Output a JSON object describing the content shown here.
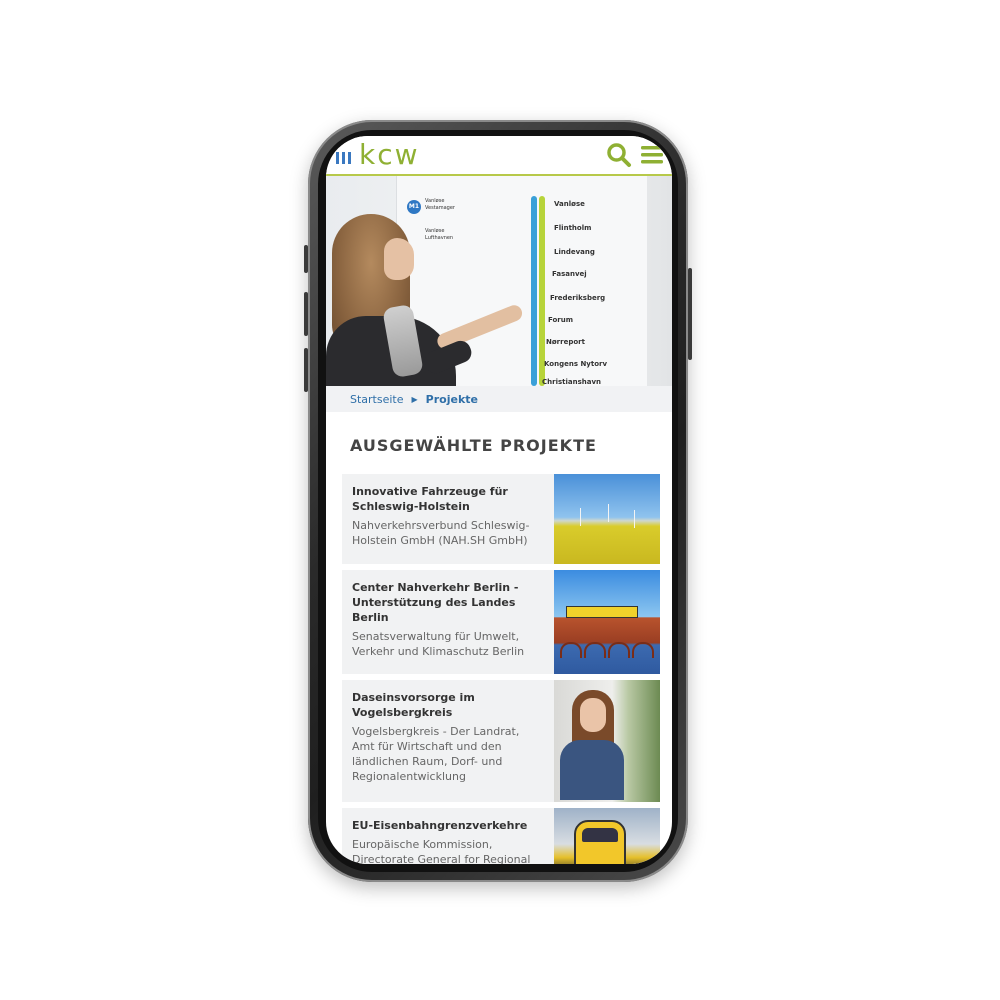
{
  "header": {
    "logo_text": "kcw",
    "search_icon": "search-icon",
    "menu_icon": "hamburger-menu-icon"
  },
  "hero": {
    "stations": [
      "Vanløse",
      "Flintholm",
      "Lindevang",
      "Fasanvej",
      "Frederiksberg",
      "Forum",
      "Nørreport",
      "Kongens Nytorv",
      "Christianshavn"
    ],
    "left_sign": {
      "badge": "M1",
      "line1": "Vanløse",
      "line2": "Vestamager",
      "line3": "Vanløse",
      "line4": "Lufthavnen"
    }
  },
  "breadcrumb": {
    "home": "Startseite",
    "separator_icon": "chevron-right-icon",
    "current": "Projekte"
  },
  "section": {
    "title": "AUSGEWÄHLTE PROJEKTE"
  },
  "projects": [
    {
      "title": "Innovative Fahrzeuge für Schleswig-Holstein",
      "client": "Nahverkehrsverbund Schleswig-Holstein GmbH (NAH.SH GmbH)"
    },
    {
      "title": "Center Nahverkehr Berlin - Unterstützung des Landes Berlin",
      "client": "Senatsverwaltung für Umwelt, Verkehr und Klimaschutz Berlin"
    },
    {
      "title": "Daseinsvorsorge im Vogelsbergkreis",
      "client": "Vogelsbergkreis - Der Landrat, Amt für Wirtschaft und den ländlichen Raum, Dorf- und Regionalentwicklung"
    },
    {
      "title": "EU-Eisenbahngrenzverkehre",
      "client": "Europäische Kommission, Directorate General for Regional"
    }
  ],
  "colors": {
    "brand_green": "#8fb033",
    "brand_blue": "#3a78c0",
    "link_blue": "#2f6fa8"
  }
}
